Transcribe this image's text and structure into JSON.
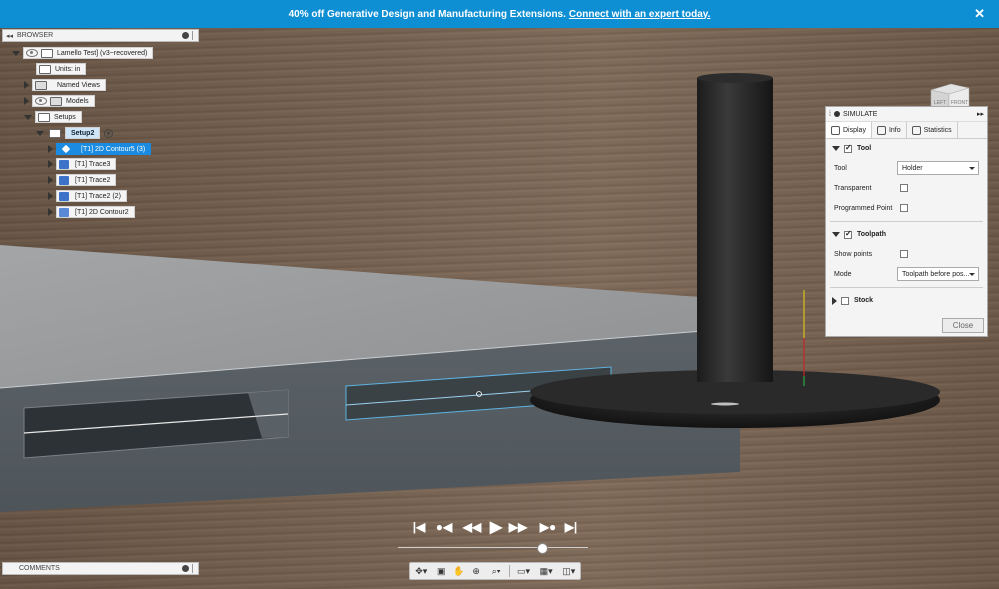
{
  "banner": {
    "text": "40% off Generative Design and Manufacturing Extensions.",
    "link": "Connect with an expert today.",
    "close": "✕"
  },
  "browser": {
    "title": "BROWSER",
    "collapse": "◂◂",
    "root": "Lamello Test] (v3~recovered)",
    "units": "Units: in",
    "named_views": "Named Views",
    "models": "Models",
    "setups": "Setups",
    "setup2": "Setup2",
    "operations": [
      "[T1] 2D Contour5 (3)",
      "[T1] Trace3",
      "[T1] Trace2",
      "[T1] Trace2 (2)",
      "[T1] 2D Contour2"
    ]
  },
  "view_cube": {
    "left": "LEFT",
    "front": "FRONT"
  },
  "simulate": {
    "title": "SIMULATE",
    "tabs": [
      "Display",
      "Info",
      "Statistics"
    ],
    "tool_section": "Tool",
    "tool_label": "Tool",
    "tool_value": "Holder",
    "transparent": "Transparent",
    "programmed_point": "Programmed Point",
    "toolpath_section": "Toolpath",
    "show_points": "Show points",
    "mode_label": "Mode",
    "mode_value": "Toolpath before pos...",
    "stock_section": "Stock",
    "close": "Close"
  },
  "comments": {
    "title": "COMMENTS"
  },
  "playback": {
    "buttons": [
      "|◀",
      "●◀",
      "◀◀",
      "▶",
      "▶▶",
      "▶●",
      "▶|"
    ],
    "position": 0.76
  }
}
